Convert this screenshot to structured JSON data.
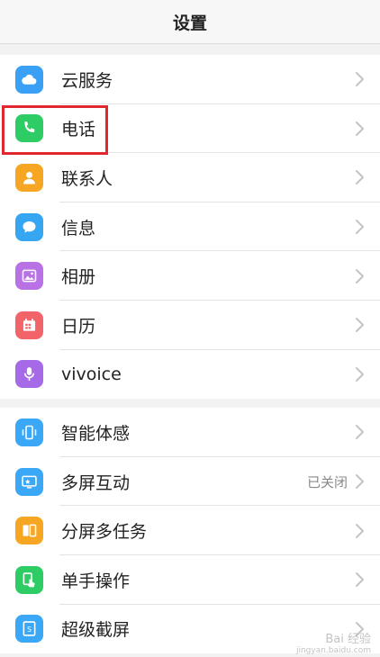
{
  "header": {
    "title": "设置"
  },
  "group1": [
    {
      "name": "cloud",
      "label": "云服务",
      "icon": "cloud-icon",
      "color": "#3aa0f5"
    },
    {
      "name": "phone",
      "label": "电话",
      "icon": "phone-icon",
      "color": "#2ecc64"
    },
    {
      "name": "contacts",
      "label": "联系人",
      "icon": "contacts-icon",
      "color": "#f6a623"
    },
    {
      "name": "messages",
      "label": "信息",
      "icon": "message-icon",
      "color": "#36a6f2"
    },
    {
      "name": "album",
      "label": "相册",
      "icon": "photo-icon",
      "color": "#b972e6"
    },
    {
      "name": "calendar",
      "label": "日历",
      "icon": "calendar-icon",
      "color": "#f3646a"
    },
    {
      "name": "vivoice",
      "label": "vivoice",
      "icon": "microphone-icon",
      "color": "#a66ae8"
    }
  ],
  "group2": [
    {
      "name": "smart-motion",
      "label": "智能体感",
      "icon": "smart-motion-icon",
      "color": "#3aa8f7"
    },
    {
      "name": "multi-screen",
      "label": "多屏互动",
      "icon": "multi-screen-icon",
      "color": "#3aa8f7",
      "status": "已关闭"
    },
    {
      "name": "split-screen",
      "label": "分屏多任务",
      "icon": "split-screen-icon",
      "color": "#f6a623"
    },
    {
      "name": "one-hand",
      "label": "单手操作",
      "icon": "one-hand-icon",
      "color": "#2ecc64"
    },
    {
      "name": "screenshot",
      "label": "超级截屏",
      "icon": "screenshot-icon",
      "color": "#3aa8f7"
    }
  ],
  "watermark": {
    "text": "Bai 经验",
    "sub": "jingyan.baidu.com"
  }
}
